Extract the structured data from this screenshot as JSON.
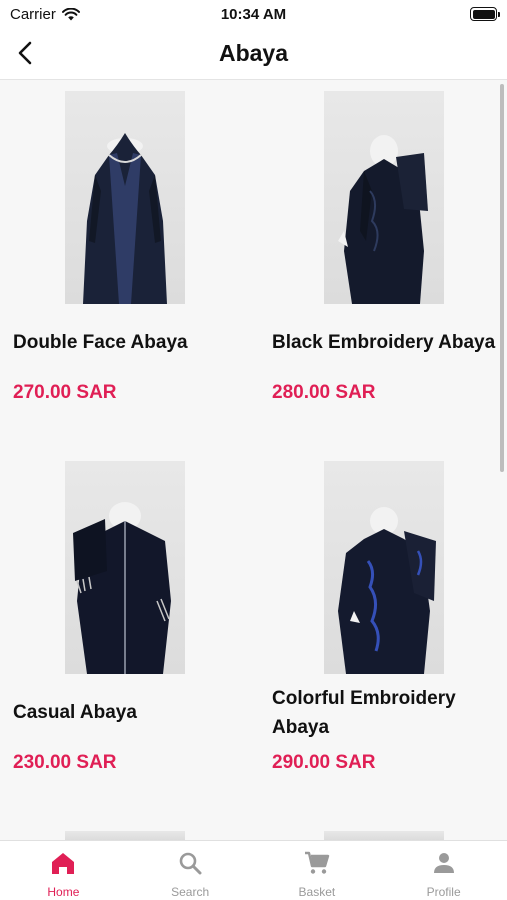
{
  "status_bar": {
    "carrier": "Carrier",
    "time": "10:34 AM"
  },
  "nav": {
    "title": "Abaya",
    "back_icon": "chevron-left-icon"
  },
  "products": [
    {
      "name": "Double Face Abaya",
      "price": "270.00 SAR"
    },
    {
      "name": "Black Embroidery Abaya",
      "price": "280.00 SAR"
    },
    {
      "name": "Casual Abaya",
      "price": "230.00 SAR"
    },
    {
      "name": "Colorful Embroidery Abaya",
      "price": "290.00 SAR"
    }
  ],
  "tabs": [
    {
      "label": "Home",
      "icon": "home-icon",
      "active": true
    },
    {
      "label": "Search",
      "icon": "search-icon",
      "active": false
    },
    {
      "label": "Basket",
      "icon": "cart-icon",
      "active": false
    },
    {
      "label": "Profile",
      "icon": "person-icon",
      "active": false
    }
  ],
  "colors": {
    "accent": "#e01f55",
    "inactive": "#9a9a9a"
  }
}
